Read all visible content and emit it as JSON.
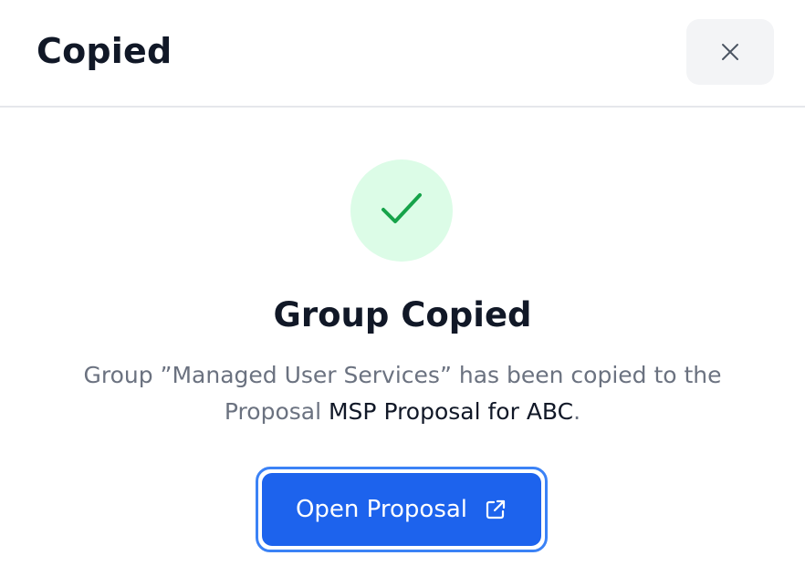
{
  "dialog": {
    "title": "Copied",
    "close_icon": "close-icon"
  },
  "success": {
    "icon": "check-icon",
    "icon_color": "#16a34a",
    "circle_color": "#dcfce7",
    "heading": "Group Copied",
    "message_prefix": "Group ”Managed User Services” has been copied to the Proposal ",
    "proposal_name": "MSP Proposal for ABC",
    "message_suffix": "."
  },
  "actions": {
    "open_label": "Open Proposal",
    "open_icon": "external-link-icon",
    "button_color": "#1d63ed"
  }
}
